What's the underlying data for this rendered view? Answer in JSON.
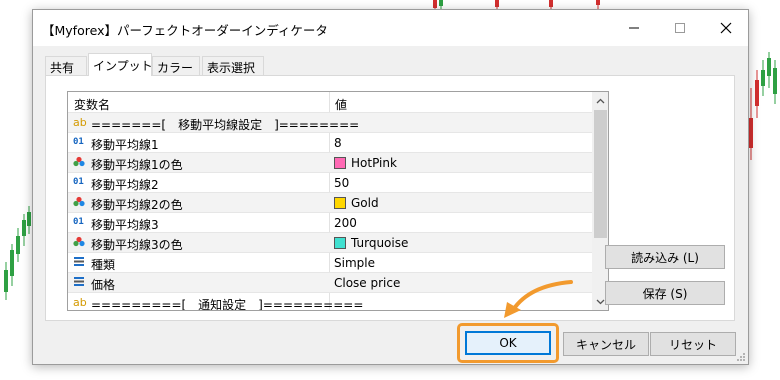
{
  "window": {
    "title": "【Myforex】パーフェクトオーダーインディケータ",
    "minimize_icon": "minimize-icon",
    "maximize_icon": "maximize-icon",
    "close_icon": "close-icon"
  },
  "tabs": [
    {
      "label": "共有",
      "active": false
    },
    {
      "label": "インプット",
      "active": true
    },
    {
      "label": "カラー",
      "active": false
    },
    {
      "label": "表示選択",
      "active": false
    }
  ],
  "grid": {
    "columns": [
      "変数名",
      "値"
    ],
    "rows": [
      {
        "icon": "ab",
        "name": "=======[　移動平均線設定　]========",
        "value": ""
      },
      {
        "icon": "01",
        "name": "移動平均線1",
        "value": "8"
      },
      {
        "icon": "color",
        "name": "移動平均線1の色",
        "value": "HotPink",
        "color": "#ff69b4"
      },
      {
        "icon": "01",
        "name": "移動平均線2",
        "value": "50"
      },
      {
        "icon": "color",
        "name": "移動平均線2の色",
        "value": "Gold",
        "color": "#ffd700"
      },
      {
        "icon": "01",
        "name": "移動平均線3",
        "value": "200"
      },
      {
        "icon": "color",
        "name": "移動平均線3の色",
        "value": "Turquoise",
        "color": "#40e0d0"
      },
      {
        "icon": "enum",
        "name": "種類",
        "value": "Simple"
      },
      {
        "icon": "enum",
        "name": "価格",
        "value": "Close price"
      },
      {
        "icon": "ab",
        "name": "=========[　通知設定　]==========",
        "value": ""
      }
    ]
  },
  "side_buttons": {
    "load": "読み込み (L)",
    "save": "保存 (S)"
  },
  "footer": {
    "ok": "OK",
    "cancel": "キャンセル",
    "reset": "リセット"
  },
  "colors": {
    "highlight": "#f29a2e",
    "focus": "#0078d7"
  }
}
